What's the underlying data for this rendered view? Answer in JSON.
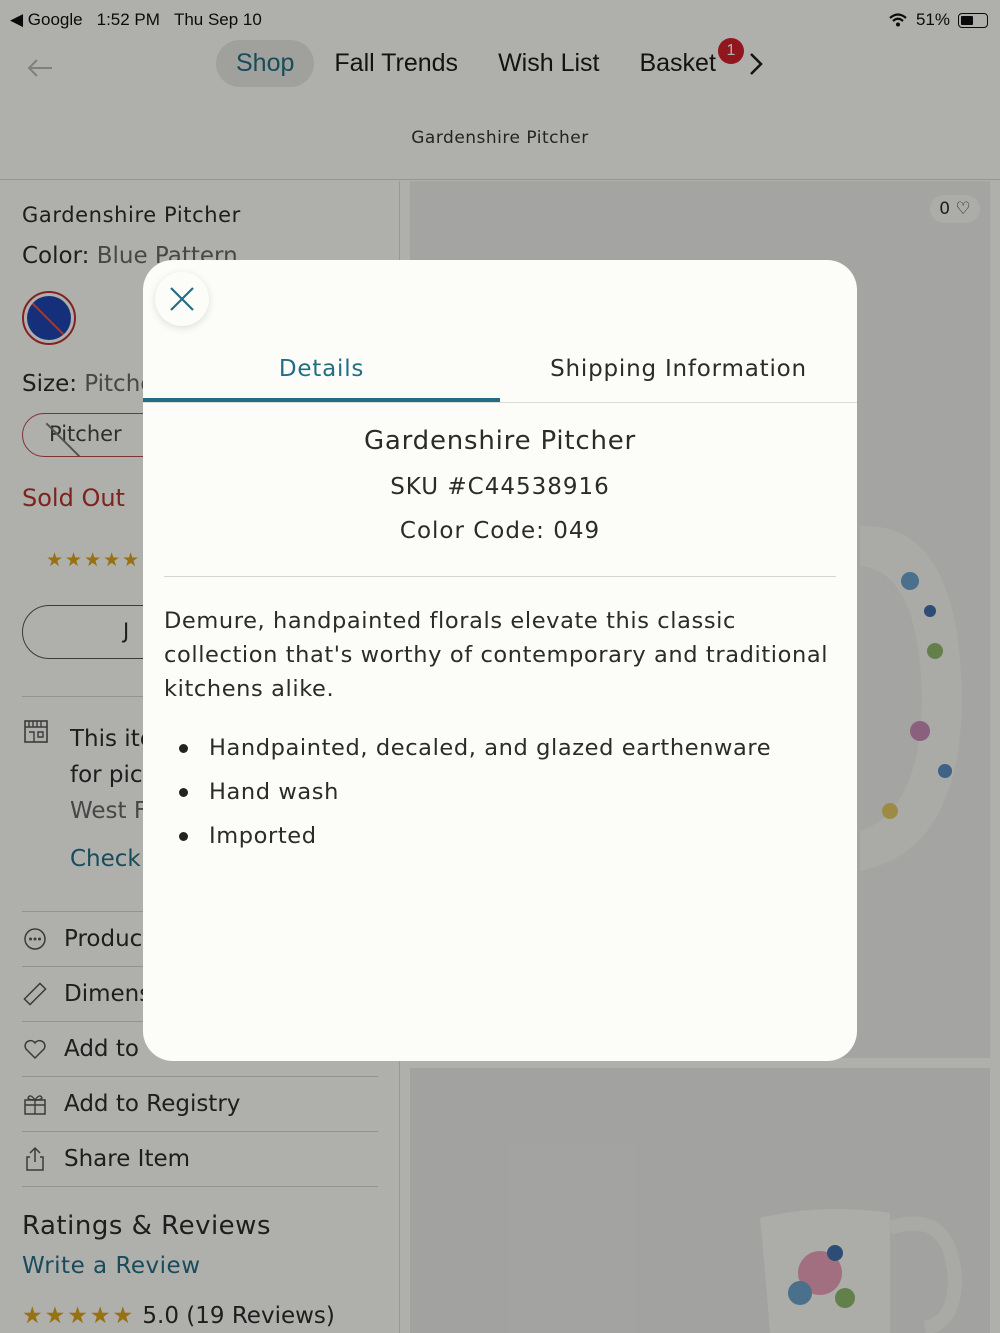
{
  "status": {
    "back_app": "◀ Google",
    "time": "1:52 PM",
    "date": "Thu Sep 10",
    "battery": "51%",
    "battery_level": 0.51
  },
  "nav": {
    "tabs": [
      {
        "label": "Shop"
      },
      {
        "label": "Fall Trends"
      },
      {
        "label": "Wish List"
      },
      {
        "label": "Basket",
        "badge": "1"
      }
    ],
    "title": "Gardenshire Pitcher"
  },
  "product": {
    "name": "Gardenshire Pitcher",
    "color_label": "Color:",
    "color_value": "Blue Pattern",
    "size_label": "Size:",
    "size_value": "Pitcher",
    "size_chip": "Pitcher",
    "stock": "Sold Out",
    "join_button": "J",
    "store": {
      "line1": "This ite",
      "line2": "for pic",
      "line3": "West F",
      "link": "Check"
    },
    "rows": [
      {
        "label": "Produc",
        "icon": "dots-icon"
      },
      {
        "label": "Dimens",
        "icon": "ruler-icon"
      },
      {
        "label": "Add to",
        "icon": "heart-icon"
      },
      {
        "label": "Add to Registry",
        "icon": "gift-icon"
      },
      {
        "label": "Share Item",
        "icon": "share-icon"
      }
    ],
    "ratings_title": "Ratings & Reviews",
    "write_review": "Write a Review",
    "rating_stars": "★★★★★",
    "rating_summary": "5.0 (19 Reviews)",
    "likes": "0"
  },
  "modal": {
    "tabs": [
      {
        "label": "Details"
      },
      {
        "label": "Shipping Information"
      }
    ],
    "title": "Gardenshire Pitcher",
    "sku": "SKU #C44538916",
    "color_code": "Color Code: 049",
    "description": "Demure, handpainted florals elevate this classic collection that's worthy of contemporary and traditional kitchens alike.",
    "bullets": [
      "Handpainted, decaled, and glazed earthenware",
      "Hand wash",
      "Imported"
    ]
  },
  "colors": {
    "accent": "#236e84",
    "sold_out": "#b3342d",
    "badge": "#d2202a",
    "star": "#d9a31a"
  }
}
